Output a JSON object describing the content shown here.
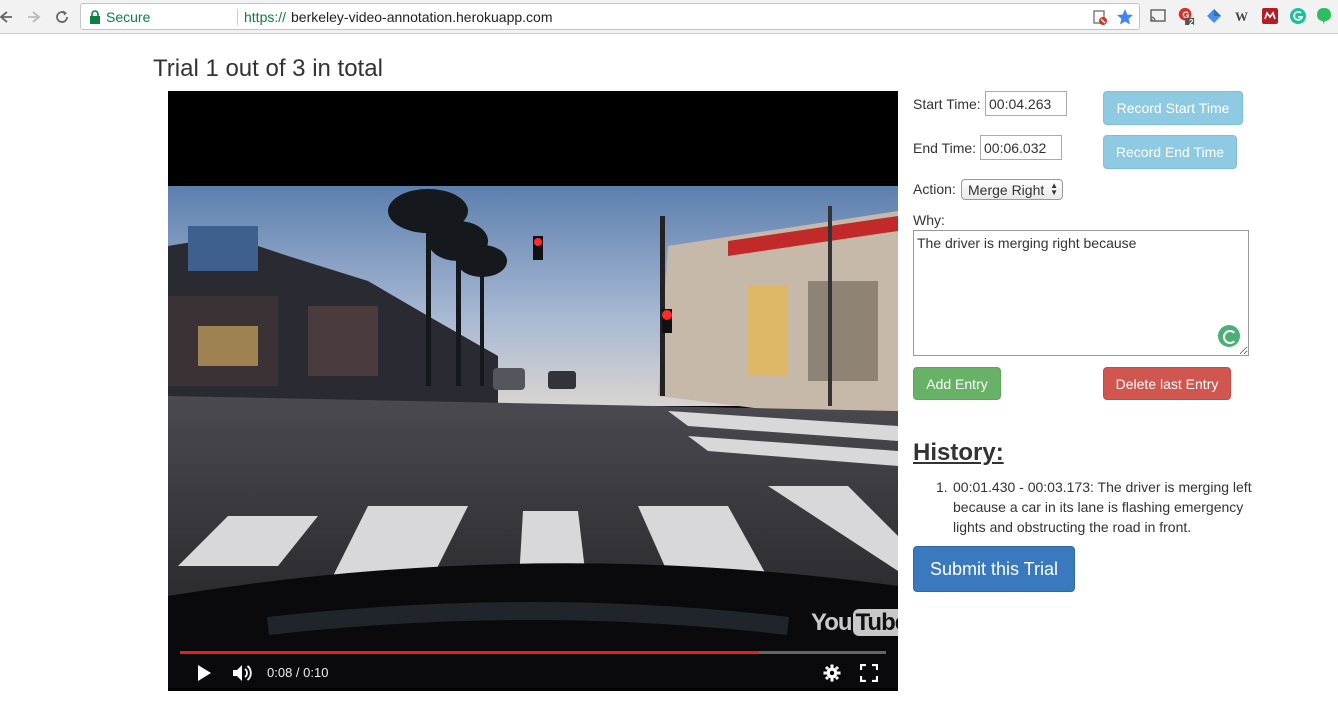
{
  "browser": {
    "secure_label": "Secure",
    "url_scheme": "https://",
    "url_host": "berkeley-video-annotation.herokuapp.com",
    "extension_badge": "2"
  },
  "page": {
    "title": "Trial 1 out of 3 in total"
  },
  "video": {
    "time_display": "0:08 / 0:10",
    "progress": 0.82,
    "logo_you": "You",
    "logo_tube": "Tube"
  },
  "form": {
    "start_time_label": "Start Time:",
    "start_time_value": "00:04.263",
    "record_start_label": "Record Start Time",
    "end_time_label": "End Time:",
    "end_time_value": "00:06.032",
    "record_end_label": "Record End Time",
    "action_label": "Action:",
    "action_selected": "Merge Right",
    "why_label": "Why:",
    "why_value": "The driver is merging right because",
    "add_entry_label": "Add Entry",
    "delete_entry_label": "Delete last Entry"
  },
  "history": {
    "title": "History:",
    "entries": [
      "00:01.430 - 00:03.173: The driver is merging left because a car in its lane is flashing emergency lights and obstructing the road in front."
    ]
  },
  "submit_label": "Submit this Trial",
  "colors": {
    "info": "#8ecae2",
    "success": "#67b266",
    "danger": "#d25650",
    "primary": "#3a79bd",
    "progress_red": "#e62117"
  }
}
